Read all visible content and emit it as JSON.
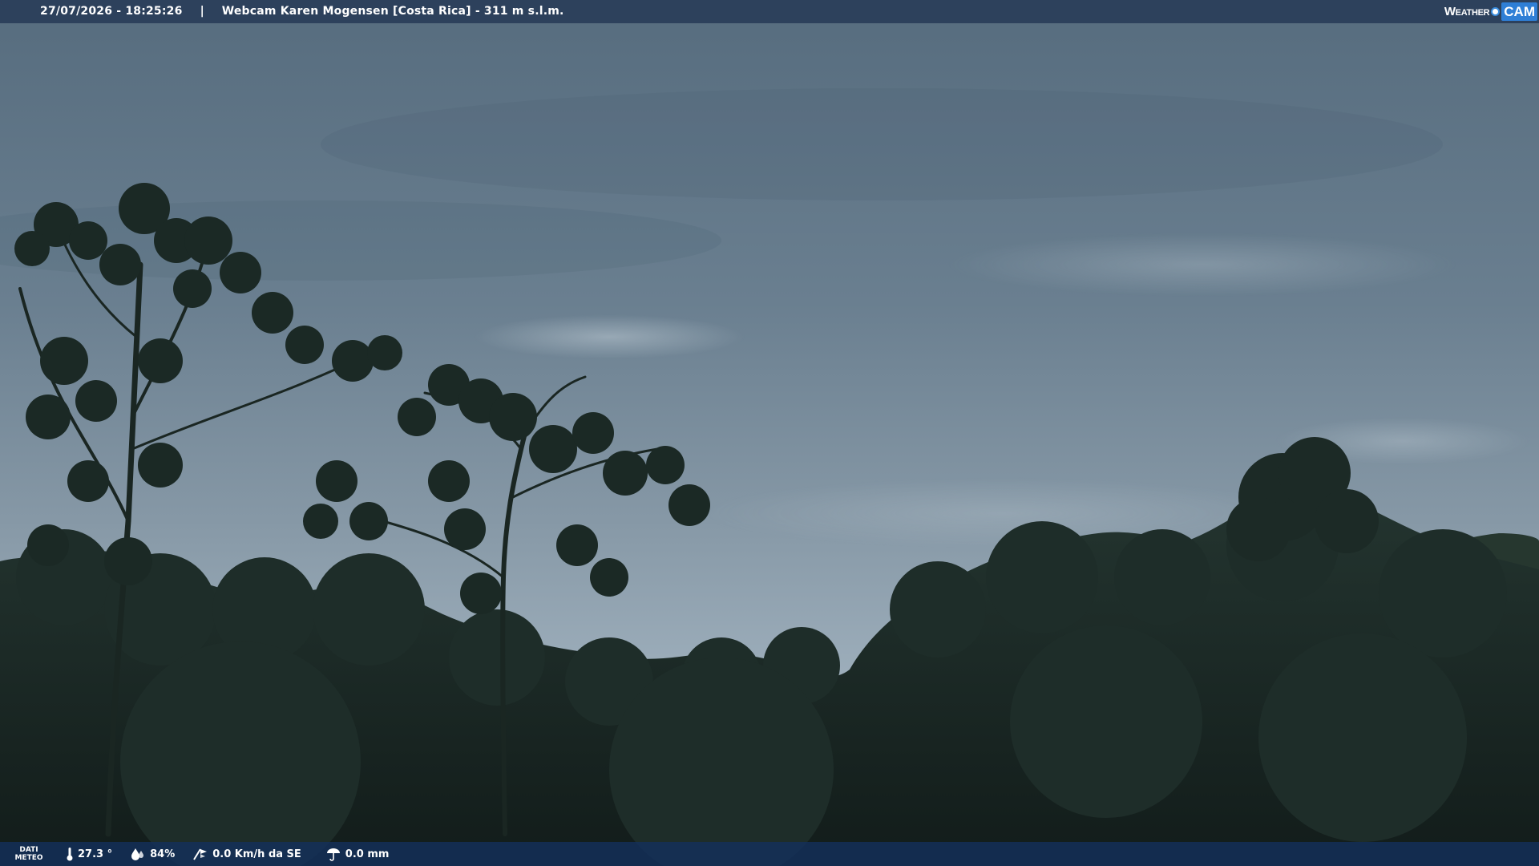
{
  "header": {
    "datetime": "27/07/2026 - 18:25:26",
    "separator": "|",
    "title": "Webcam Karen Mogensen [Costa Rica]  - 311 m s.l.m."
  },
  "logo": {
    "word": "Weather",
    "cam": "CAM",
    "brand_color": "#2f7fd6"
  },
  "weather": {
    "label_line1": "DATI",
    "label_line2": "METEO",
    "temperature": "27.3 °",
    "humidity": "84%",
    "wind": "0.0 Km/h da SE",
    "rain": "0.0 mm",
    "icons": [
      "thermometer-icon",
      "humidity-drop-icon",
      "wind-icon",
      "rain-icon"
    ]
  },
  "scene": {
    "description_colors": {
      "sky_top": "#5a6f80",
      "sky_bottom": "#9aabb8",
      "foliage": "#1b2a26"
    }
  }
}
